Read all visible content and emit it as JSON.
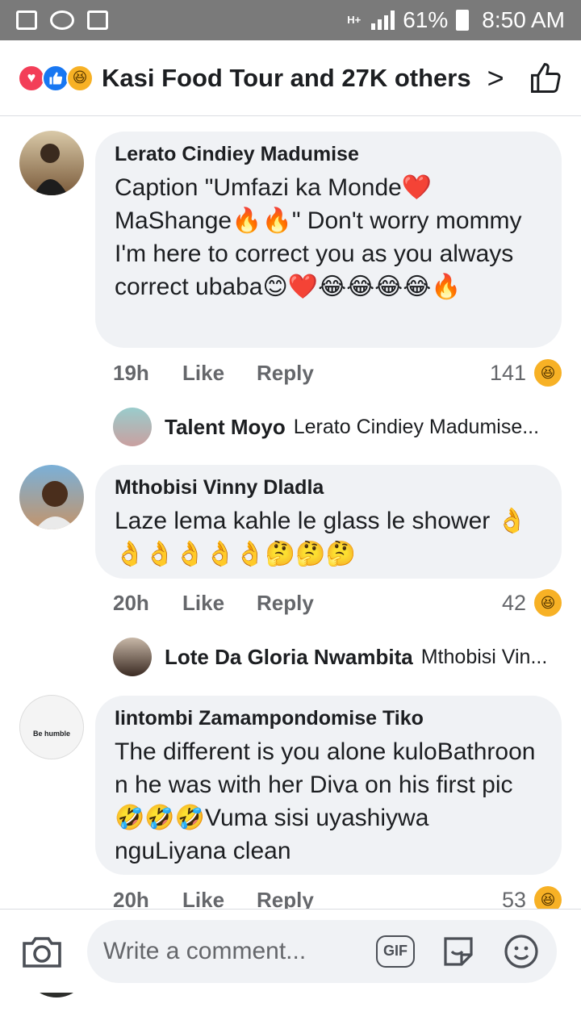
{
  "status_bar": {
    "battery": "61%",
    "time": "8:50 AM",
    "network": "H+"
  },
  "reactions": {
    "summary": "Kasi Food Tour and 27K others",
    "chevron": ">"
  },
  "comments": [
    {
      "author": "Lerato Cindiey Madumise",
      "text": "Caption \"Umfazi ka Monde❤️ MaShange🔥🔥\" Don't worry mommy I'm here to correct you as you always correct ubaba😊❤️😂😂😂😂🔥",
      "time": "19h",
      "like": "Like",
      "reply": "Reply",
      "count": "141",
      "reply_preview": {
        "author": "Talent Moyo",
        "text": "Lerato Cindiey Madumise..."
      }
    },
    {
      "author": "Mthobisi Vinny Dladla",
      "text": "Laze lema kahle le glass le shower 👌👌👌👌👌👌🤔🤔🤔",
      "time": "20h",
      "like": "Like",
      "reply": "Reply",
      "count": "42",
      "reply_preview": {
        "author": "Lote Da Gloria Nwambita",
        "text": "Mthobisi Vin..."
      }
    },
    {
      "author": "Iintombi Zamampondomise Tiko",
      "text": "The different is you alone kuloBathroon n he was with her Diva on his first pic  🤣🤣🤣Vuma sisi uyashiywa nguLiyana clean",
      "time": "20h",
      "like": "Like",
      "reply": "Reply",
      "count": "53",
      "avatar_text": "Be humble"
    }
  ],
  "composer": {
    "placeholder": "Write a comment...",
    "gif": "GIF"
  }
}
